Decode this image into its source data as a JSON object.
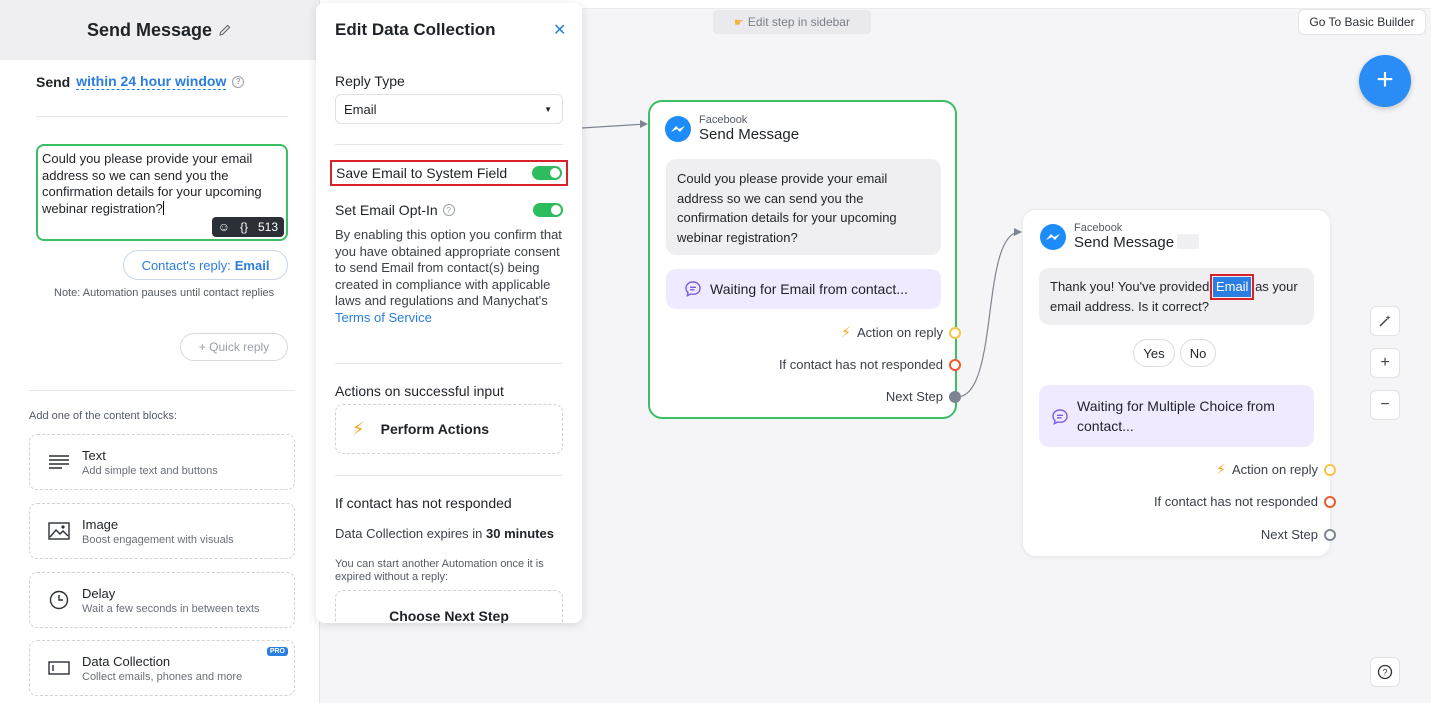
{
  "canvas": {
    "edit_hint": "Edit step in sidebar",
    "basic_builder_label": "Go To Basic Builder",
    "add_label": "+",
    "zoom_in_label": "+",
    "zoom_out_label": "−"
  },
  "sidebar": {
    "title": "Send Message",
    "send_label": "Send",
    "send_window": "within 24 hour window",
    "message_text": "Could you please provide your email address so we can send you the confirmation details for your upcoming webinar registration?",
    "message_tools": {
      "variables": "{}",
      "char_count": "513"
    },
    "reply_prefix": "Contact's reply:",
    "reply_type": "Email",
    "note": "Note: Automation pauses until contact replies",
    "quick_reply": "+ Quick reply",
    "add_blocks_label": "Add one of the content blocks:",
    "blocks": [
      {
        "title": "Text",
        "desc": "Add simple text and buttons",
        "icon": "text-lines-icon"
      },
      {
        "title": "Image",
        "desc": "Boost engagement with visuals",
        "icon": "image-icon"
      },
      {
        "title": "Delay",
        "desc": "Wait a few seconds in between texts",
        "icon": "clock-icon"
      },
      {
        "title": "Data Collection",
        "desc": "Collect emails, phones and more",
        "icon": "input-field-icon",
        "badge": "PRO"
      }
    ]
  },
  "panel": {
    "title": "Edit Data Collection",
    "reply_type_label": "Reply Type",
    "reply_type_value": "Email",
    "save_email_label": "Save Email to System Field",
    "save_email_on": true,
    "optin_label": "Set Email Opt-In",
    "optin_on": true,
    "optin_desc": "By enabling this option you confirm that you have obtained appropriate consent to send Email from contact(s) being created in compliance with applicable laws and regulations and Manychat's ",
    "terms_link": "Terms of Service",
    "actions_heading": "Actions on successful input",
    "perform_actions": "Perform Actions",
    "no_response_heading": "If contact has not responded",
    "expires_prefix": "Data Collection expires in",
    "expires_value": "30 minutes",
    "expires_note": "You can start another Automation once it is expired without a reply:",
    "choose_next": "Choose Next Step"
  },
  "node1": {
    "source": "Facebook",
    "title": "Send Message",
    "message": "Could you please provide your email address so we can send you the confirmation details for your upcoming webinar registration?",
    "waiting": "Waiting for Email from contact...",
    "ports": {
      "action": "Action on reply",
      "no_response": "If contact has not responded",
      "next": "Next Step"
    }
  },
  "node2": {
    "source": "Facebook",
    "title": "Send Message",
    "message_before": "Thank you! You've provided ",
    "message_var": "Email",
    "message_after": " as your email address. Is it correct?",
    "choices": [
      "Yes",
      "No"
    ],
    "waiting": "Waiting for Multiple Choice from contact...",
    "ports": {
      "action": "Action on reply",
      "no_response": "If contact has not responded",
      "next": "Next Step"
    }
  },
  "colors": {
    "accent": "#2a8cf5",
    "green": "#3cbf64",
    "highlight_red": "#d8222a",
    "port_action": "#f7c448",
    "port_no_response": "#ef5b2f",
    "port_next": "#7d8591"
  }
}
